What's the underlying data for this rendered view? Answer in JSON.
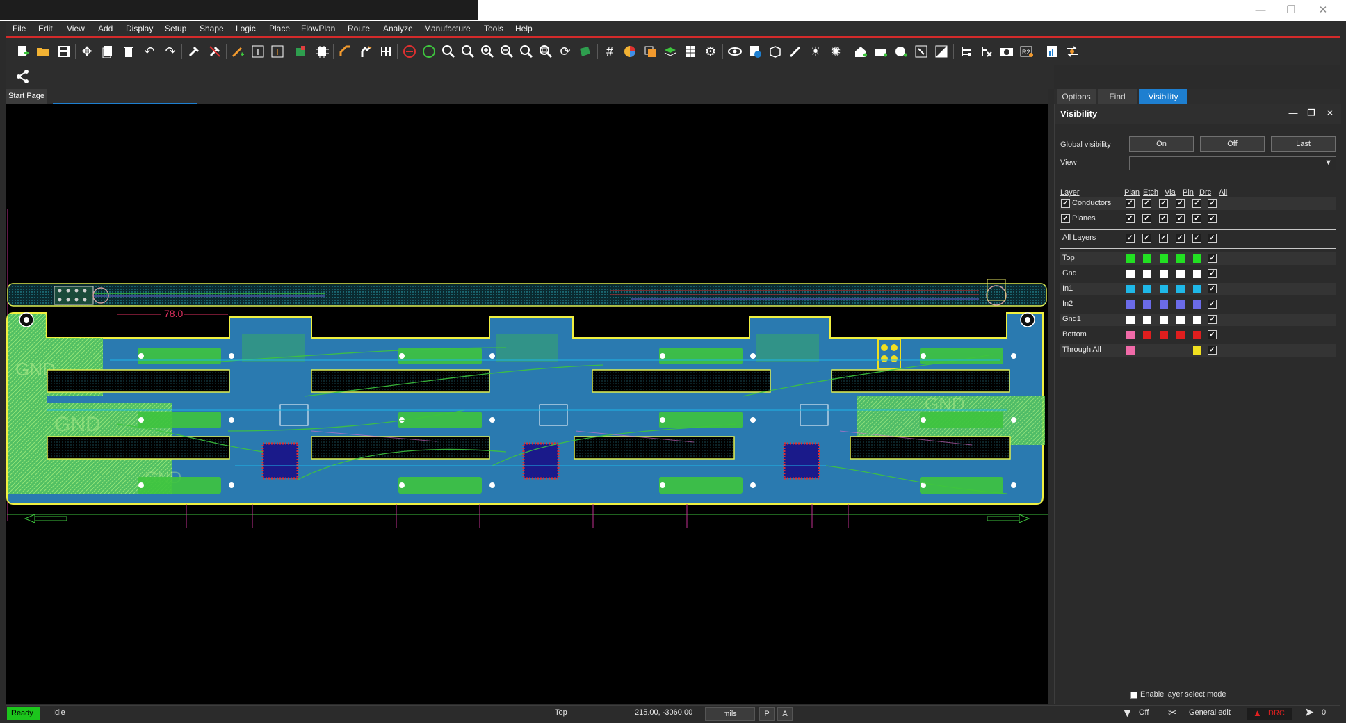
{
  "menu": [
    "File",
    "Edit",
    "View",
    "Add",
    "Display",
    "Setup",
    "Shape",
    "Logic",
    "Place",
    "FlowPlan",
    "Route",
    "Analyze",
    "Manufacture",
    "Tools",
    "Help"
  ],
  "window_buttons": {
    "minimize": "—",
    "restore": "❐",
    "close": "✕"
  },
  "toolbar_icons": [
    "new-file-icon",
    "open-folder-icon",
    "save-icon",
    "move-icon",
    "copy-icon",
    "delete-icon",
    "undo-icon",
    "redo-icon",
    "pin-icon",
    "unpin-icon",
    "add-trace-icon",
    "text-icon",
    "edit-text-icon",
    "component-icon",
    "chip-icon",
    "route-icon",
    "hand-route-icon",
    "fanout-icon",
    "no-entry-icon",
    "drc-icon",
    "zoom-out-icon",
    "zoom-icon",
    "zoom-in-icon",
    "zoom-minus-icon",
    "zoom-board-icon",
    "zoom-extents-icon",
    "refresh-icon",
    "board-icon",
    "grid-icon",
    "color-wheel-icon",
    "layers-icon",
    "layers-stack-icon",
    "spreadsheet-icon",
    "settings-icon",
    "eye-icon",
    "info-icon",
    "3d-icon",
    "wand-icon",
    "sun-icon",
    "light-icon",
    "home-icon",
    "board-shape-icon",
    "plane-icon",
    "cursor-box-icon",
    "diagonal-icon",
    "netlist-icon",
    "unroute-icon",
    "camera-icon",
    "r2-icon",
    "report-icon",
    "swap-icon"
  ],
  "share_icon": "share-icon",
  "doc_tab": "Start Page",
  "panel": {
    "tabs": [
      "Options",
      "Find",
      "Visibility"
    ],
    "active_tab": "Visibility",
    "title": "Visibility",
    "global_label": "Global visibility",
    "buttons": [
      "On",
      "Off",
      "Last"
    ],
    "view_label": "View",
    "view_value": "",
    "columns": [
      "Layer",
      "Plan",
      "Etch",
      "Via",
      "Pin",
      "Drc",
      "All"
    ],
    "groups": [
      {
        "name": "Conductors",
        "checked": true
      },
      {
        "name": "Planes",
        "checked": true
      }
    ],
    "all_layers": "All Layers",
    "layers": [
      {
        "name": "Top",
        "colors": [
          "#22e022",
          "#22e022",
          "#22e022",
          "#22e022",
          "#22e022"
        ]
      },
      {
        "name": "Gnd",
        "colors": [
          "#ffffff",
          "#ffffff",
          "#ffffff",
          "#ffffff",
          "#ffffff"
        ]
      },
      {
        "name": "In1",
        "colors": [
          "#1fb8e8",
          "#1fb8e8",
          "#1fb8e8",
          "#1fb8e8",
          "#1fb8e8"
        ]
      },
      {
        "name": "In2",
        "colors": [
          "#6b6be8",
          "#6b6be8",
          "#6b6be8",
          "#6b6be8",
          "#6b6be8"
        ]
      },
      {
        "name": "Gnd1",
        "colors": [
          "#ffffff",
          "#ffffff",
          "#ffffff",
          "#ffffff",
          "#ffffff"
        ]
      },
      {
        "name": "Bottom",
        "colors": [
          "#f06aa8",
          "#e01e1e",
          "#e01e1e",
          "#e01e1e",
          "#e01e1e"
        ]
      },
      {
        "name": "Through All",
        "colors": [
          "#f06aa8",
          "",
          "",
          "",
          "#f0e020"
        ]
      }
    ],
    "layer_select_label": "Enable layer select mode"
  },
  "canvas": {
    "dimension_label": "78.0",
    "net_label": "GND"
  },
  "status": {
    "ready": "Ready",
    "state": "Idle",
    "layer": "Top",
    "coords": "215.00, -3060.00",
    "units": "mils",
    "p": "P",
    "a": "A",
    "filter": "Off",
    "mode": "General edit",
    "drc": "DRC",
    "count": "0"
  }
}
